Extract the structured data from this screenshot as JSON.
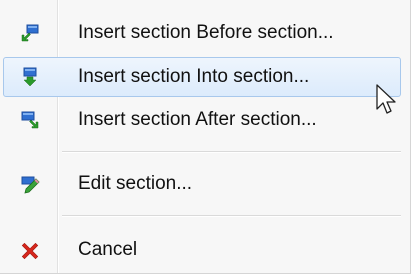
{
  "menu": {
    "items": [
      {
        "label": "Insert section Before section...",
        "icon": "insert-before-icon"
      },
      {
        "label": "Insert section Into section...",
        "icon": "insert-into-icon",
        "highlighted": true
      },
      {
        "label": "Insert section After section...",
        "icon": "insert-after-icon"
      },
      {
        "label": "Edit section...",
        "icon": "edit-pencil-icon"
      },
      {
        "label": "Cancel",
        "icon": "cancel-x-icon"
      }
    ]
  },
  "colors": {
    "highlight_border": "#a8c8ec",
    "highlight_fill": "#dcebfc",
    "icon_blue": "#2f6fd0",
    "icon_green": "#2a9a2a",
    "cancel_red": "#d8261c"
  }
}
